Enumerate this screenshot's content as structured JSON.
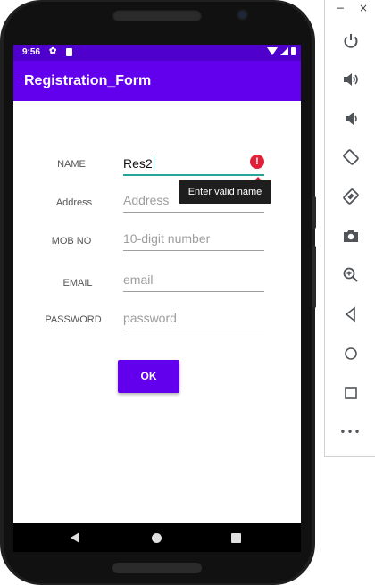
{
  "status_bar": {
    "time": "9:56"
  },
  "app_bar": {
    "title": "Registration_Form"
  },
  "form": {
    "name": {
      "label": "NAME",
      "value": "Res2"
    },
    "address": {
      "label": "Address",
      "placeholder": "Address"
    },
    "mobile": {
      "label": "MOB NO",
      "placeholder": "10-digit number"
    },
    "email": {
      "label": "EMAIL",
      "placeholder": "email"
    },
    "password": {
      "label": "PASSWORD",
      "placeholder": "password"
    },
    "error_icon": "!",
    "error_message": "Enter valid name",
    "ok_label": "OK"
  },
  "colors": {
    "primary": "#6200ee",
    "primary_dark": "#4f00cc",
    "accent": "#26a69a",
    "error": "#e0203a"
  },
  "emulator_toolbar": {
    "minimize": "−",
    "close": "×",
    "more": "•••",
    "icons": [
      "power-icon",
      "volume-up-icon",
      "volume-down-icon",
      "rotate-left-icon",
      "rotate-right-icon",
      "camera-icon",
      "zoom-icon",
      "back-icon",
      "home-icon",
      "overview-icon",
      "more-icon"
    ]
  }
}
